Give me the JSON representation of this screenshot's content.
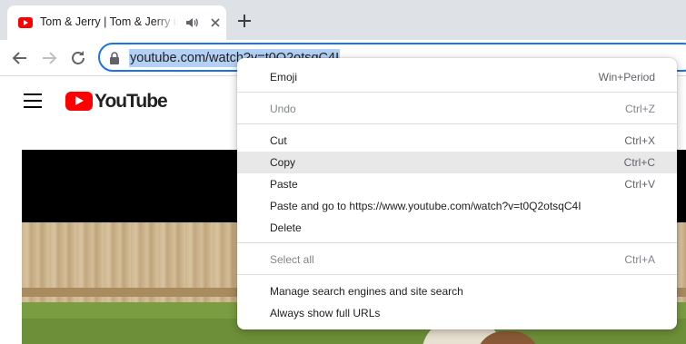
{
  "tab": {
    "title": "Tom & Jerry | Tom & Jerry in Full Screen"
  },
  "toolbar": {
    "url": "youtube.com/watch?v=t0Q2otsqC4I"
  },
  "youtube": {
    "wordmark": "YouTube"
  },
  "context_menu": {
    "emoji": {
      "label": "Emoji",
      "shortcut": "Win+Period"
    },
    "undo": {
      "label": "Undo",
      "shortcut": "Ctrl+Z"
    },
    "cut": {
      "label": "Cut",
      "shortcut": "Ctrl+X"
    },
    "copy": {
      "label": "Copy",
      "shortcut": "Ctrl+C"
    },
    "paste": {
      "label": "Paste",
      "shortcut": "Ctrl+V"
    },
    "paste_go": {
      "label": "Paste and go to https://www.youtube.com/watch?v=t0Q2otsqC4I"
    },
    "delete": {
      "label": "Delete"
    },
    "select_all": {
      "label": "Select all",
      "shortcut": "Ctrl+A"
    },
    "manage_search": {
      "label": "Manage search engines and site search"
    },
    "show_urls": {
      "label": "Always show full URLs"
    }
  },
  "colors": {
    "omnibox_focus": "#1a73e8",
    "url_selection": "#b3d0f5",
    "youtube_red": "#ff0000"
  }
}
